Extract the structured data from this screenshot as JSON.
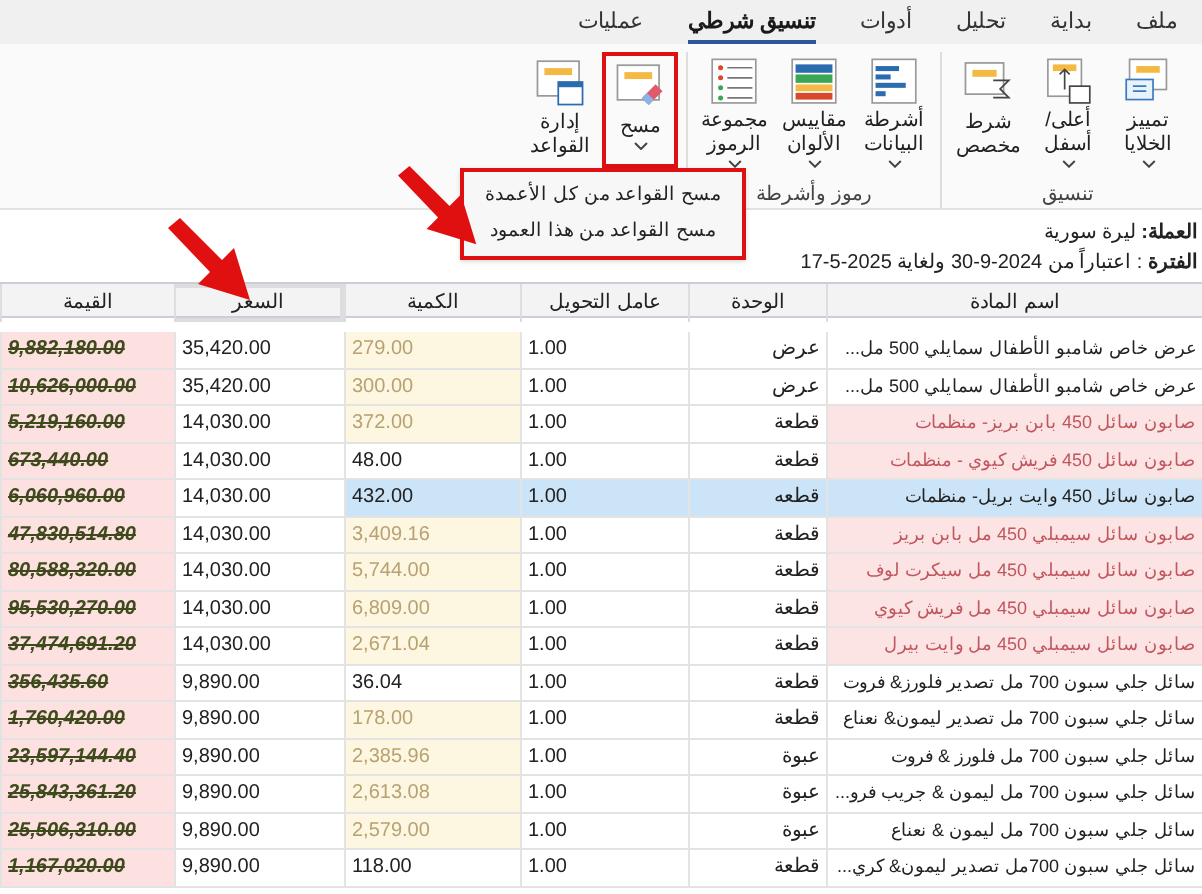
{
  "tabs": [
    {
      "label": "ملف",
      "selected": false
    },
    {
      "label": "بداية",
      "selected": false
    },
    {
      "label": "تحليل",
      "selected": false
    },
    {
      "label": "أدوات",
      "selected": false
    },
    {
      "label": "تنسيق شرطي",
      "selected": true
    },
    {
      "label": "عمليات",
      "selected": false
    }
  ],
  "ribbon": {
    "groups": [
      {
        "label": "تنسيق",
        "buttons": [
          {
            "kind": "highlight",
            "label": "تمييز\nالخلايا",
            "dropdown": true,
            "outlined": false
          },
          {
            "kind": "topbottom",
            "label": "أعلى/أسفل",
            "dropdown": true,
            "outlined": false
          },
          {
            "kind": "custom",
            "label": "شرط\nمخصص",
            "dropdown": false,
            "outlined": false
          }
        ]
      },
      {
        "label": "رموز وأشرطة",
        "buttons": [
          {
            "kind": "databars",
            "label": "أشرطة\nالبيانات",
            "dropdown": true,
            "outlined": false
          },
          {
            "kind": "colorscales",
            "label": "مقاييس\nالألوان",
            "dropdown": true,
            "outlined": false
          },
          {
            "kind": "iconsets",
            "label": "مجموعة\nالرموز",
            "dropdown": true,
            "outlined": false
          }
        ]
      },
      {
        "buttons": [
          {
            "kind": "clear",
            "label": "مسح",
            "dropdown": true,
            "outlined": true
          },
          {
            "kind": "manage",
            "label": "إدارة\nالقواعد",
            "dropdown": false,
            "outlined": false
          }
        ]
      }
    ]
  },
  "menu": {
    "items": [
      "مسح القواعد من كل الأعمدة",
      "مسح القواعد من هذا العمود"
    ]
  },
  "info": [
    "**العملة:** ليرة سورية",
    "**الفترة** : اعتباراً من 2024-9-30 ولغاية 2025-5-17"
  ],
  "table": {
    "columns": [
      {
        "label": "اسم المادة",
        "outlined": false
      },
      {
        "label": "الوحدة",
        "outlined": false
      },
      {
        "label": "عامل التحويل",
        "outlined": false
      },
      {
        "label": "الكمية",
        "outlined": false
      },
      {
        "label": "السعر",
        "outlined": true
      },
      {
        "label": "القيمة",
        "outlined": false
      }
    ],
    "rows": [
      {
        "name": "عرض خاص شامبو الأطفال سمايلي 500 مل...",
        "name_flagged": false,
        "unit": "عرض",
        "factor": "1.00",
        "qty": "279.00",
        "qty_flagged": true,
        "price": "35,420.00",
        "value": "9,882,180.00",
        "selected": false
      },
      {
        "name": "عرض خاص شامبو الأطفال سمايلي 500 مل...",
        "name_flagged": false,
        "unit": "عرض",
        "factor": "1.00",
        "qty": "300.00",
        "qty_flagged": true,
        "price": "35,420.00",
        "value": "10,626,000.00",
        "selected": false
      },
      {
        "name": "صابون سائل 450 بابن بريز- منظمات",
        "name_flagged": true,
        "unit": "قطعة",
        "factor": "1.00",
        "qty": "372.00",
        "qty_flagged": true,
        "price": "14,030.00",
        "value": "5,219,160.00",
        "selected": false
      },
      {
        "name": "صابون سائل 450 فريش كيوي - منظمات",
        "name_flagged": true,
        "unit": "قطعة",
        "factor": "1.00",
        "qty": "48.00",
        "qty_flagged": false,
        "price": "14,030.00",
        "value": "673,440.00",
        "selected": false
      },
      {
        "name": "صابون سائل 450 وايت بريل- منظمات",
        "name_flagged": false,
        "unit": "قطعه",
        "factor": "1.00",
        "qty": "432.00",
        "qty_flagged": false,
        "price": "14,030.00",
        "value": "6,060,960.00",
        "selected": true
      },
      {
        "name": "صابون سائل سيمبلي 450 مل بابن بريز",
        "name_flagged": true,
        "unit": "قطعة",
        "factor": "1.00",
        "qty": "3,409.16",
        "qty_flagged": true,
        "price": "14,030.00",
        "value": "47,830,514.80",
        "selected": false
      },
      {
        "name": "صابون سائل سيمبلي 450 مل سيكرت لوف",
        "name_flagged": true,
        "unit": "قطعة",
        "factor": "1.00",
        "qty": "5,744.00",
        "qty_flagged": true,
        "price": "14,030.00",
        "value": "80,588,320.00",
        "selected": false
      },
      {
        "name": "صابون سائل سيمبلي 450 مل فريش كيوي",
        "name_flagged": true,
        "unit": "قطعة",
        "factor": "1.00",
        "qty": "6,809.00",
        "qty_flagged": true,
        "price": "14,030.00",
        "value": "95,530,270.00",
        "selected": false
      },
      {
        "name": "صابون سائل سيمبلي 450 مل وايت بيرل",
        "name_flagged": true,
        "unit": "قطعة",
        "factor": "1.00",
        "qty": "2,671.04",
        "qty_flagged": true,
        "price": "14,030.00",
        "value": "37,474,691.20",
        "selected": false
      },
      {
        "name": "سائل جلي سبون 700 مل تصدير فلورز& فروت",
        "name_flagged": false,
        "unit": "قطعة",
        "factor": "1.00",
        "qty": "36.04",
        "qty_flagged": false,
        "price": "9,890.00",
        "value": "356,435.60",
        "selected": false
      },
      {
        "name": "سائل جلي سبون 700 مل تصدير ليمون& نعناع",
        "name_flagged": false,
        "unit": "قطعة",
        "factor": "1.00",
        "qty": "178.00",
        "qty_flagged": true,
        "price": "9,890.00",
        "value": "1,760,420.00",
        "selected": false
      },
      {
        "name": "سائل جلي سبون 700 مل فلورز & فروت",
        "name_flagged": false,
        "unit": "عبوة",
        "factor": "1.00",
        "qty": "2,385.96",
        "qty_flagged": true,
        "price": "9,890.00",
        "value": "23,597,144.40",
        "selected": false
      },
      {
        "name": "سائل جلي سبون 700 مل ليمون & جريب فرو...",
        "name_flagged": false,
        "unit": "عبوة",
        "factor": "1.00",
        "qty": "2,613.08",
        "qty_flagged": true,
        "price": "9,890.00",
        "value": "25,843,361.20",
        "selected": false
      },
      {
        "name": "سائل جلي سبون 700 مل ليمون & نعناع",
        "name_flagged": false,
        "unit": "عبوة",
        "factor": "1.00",
        "qty": "2,579.00",
        "qty_flagged": true,
        "price": "9,890.00",
        "value": "25,506,310.00",
        "selected": false
      },
      {
        "name": "سائل جلي سبون 700مل تصدير ليمون& كري...",
        "name_flagged": false,
        "unit": "قطعة",
        "factor": "1.00",
        "qty": "118.00",
        "qty_flagged": false,
        "price": "9,890.00",
        "value": "1,167,020.00",
        "selected": false
      }
    ]
  }
}
